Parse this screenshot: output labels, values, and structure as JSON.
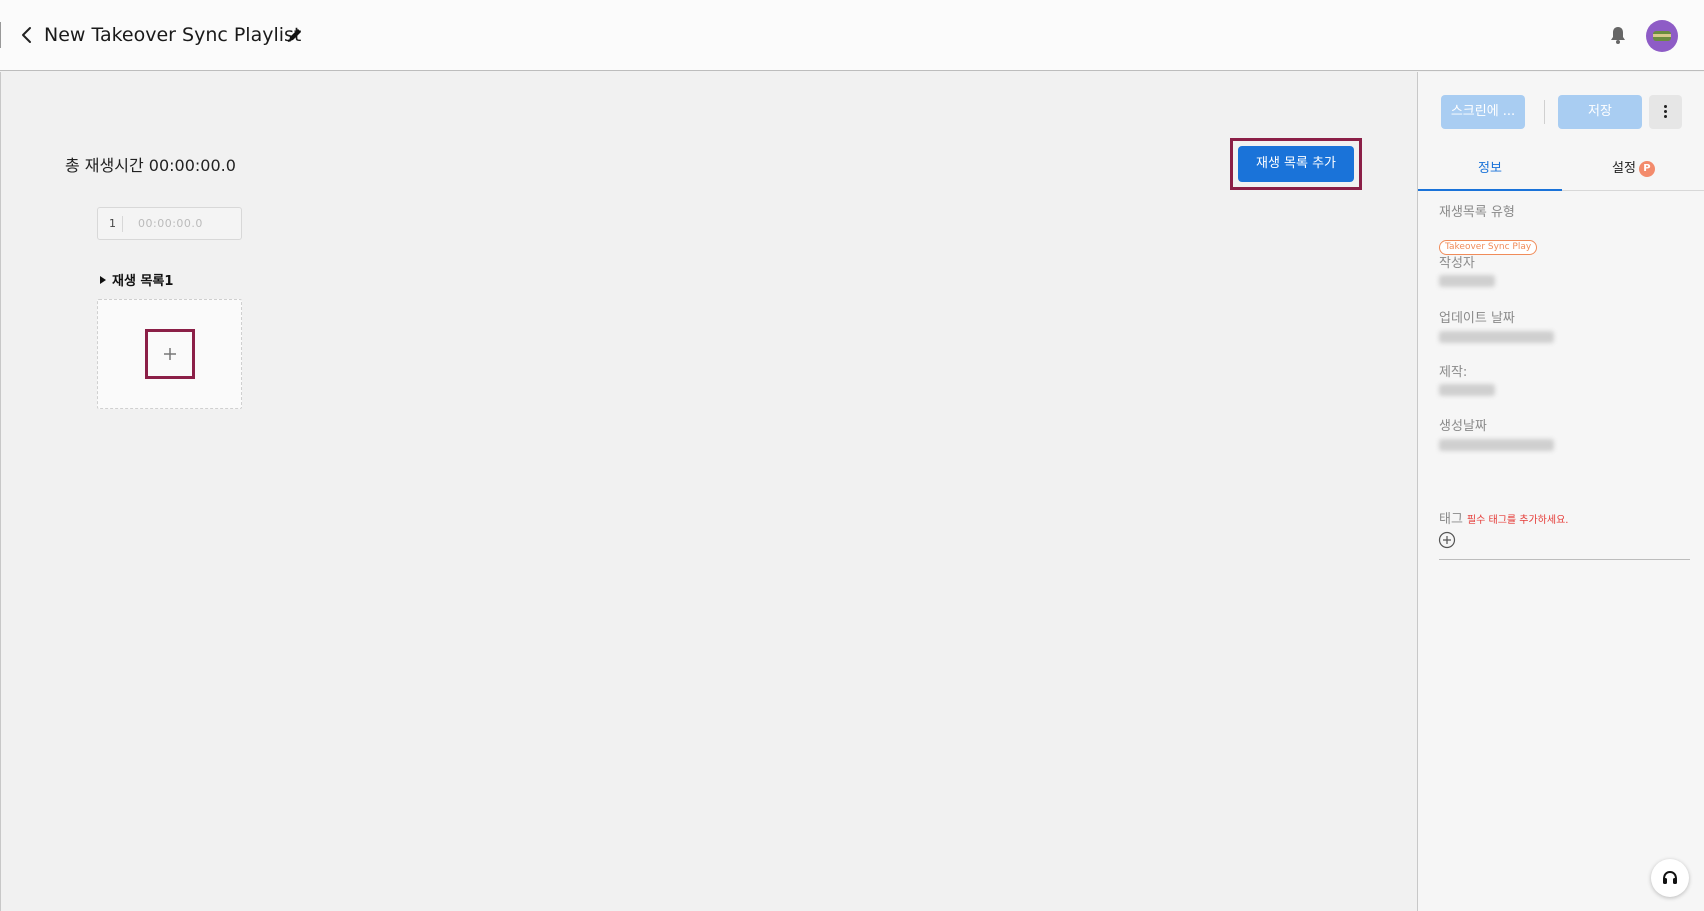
{
  "header": {
    "title": "New Takeover Sync Playlist"
  },
  "main": {
    "total_label": "총 재생시간 00:00:00.0",
    "add_playlist_button": "재생 목록 추가",
    "timeline": {
      "index": "1",
      "time": "00:00:00.0"
    },
    "playlist_label": "재생 목록1"
  },
  "panel": {
    "screen_button": "스크린에 ...",
    "save_button": "저장",
    "tabs": {
      "info": "정보",
      "settings": "설정",
      "settings_badge": "P"
    },
    "fields": {
      "playlist_type_label": "재생목록 유형",
      "playlist_type_value": "Takeover Sync Play",
      "author_label": "작성자",
      "updated_label": "업데이트 날짜",
      "producer_label": "제작:",
      "created_label": "생성날짜",
      "tag_label": "태그",
      "tag_required": "필수 태그를 추가하세요."
    }
  },
  "colors": {
    "primary": "#1a73d9",
    "primary_disabled": "#a9cdf2",
    "highlight": "#8b1f47",
    "required": "#e53935",
    "badge": "#f08c5a"
  }
}
